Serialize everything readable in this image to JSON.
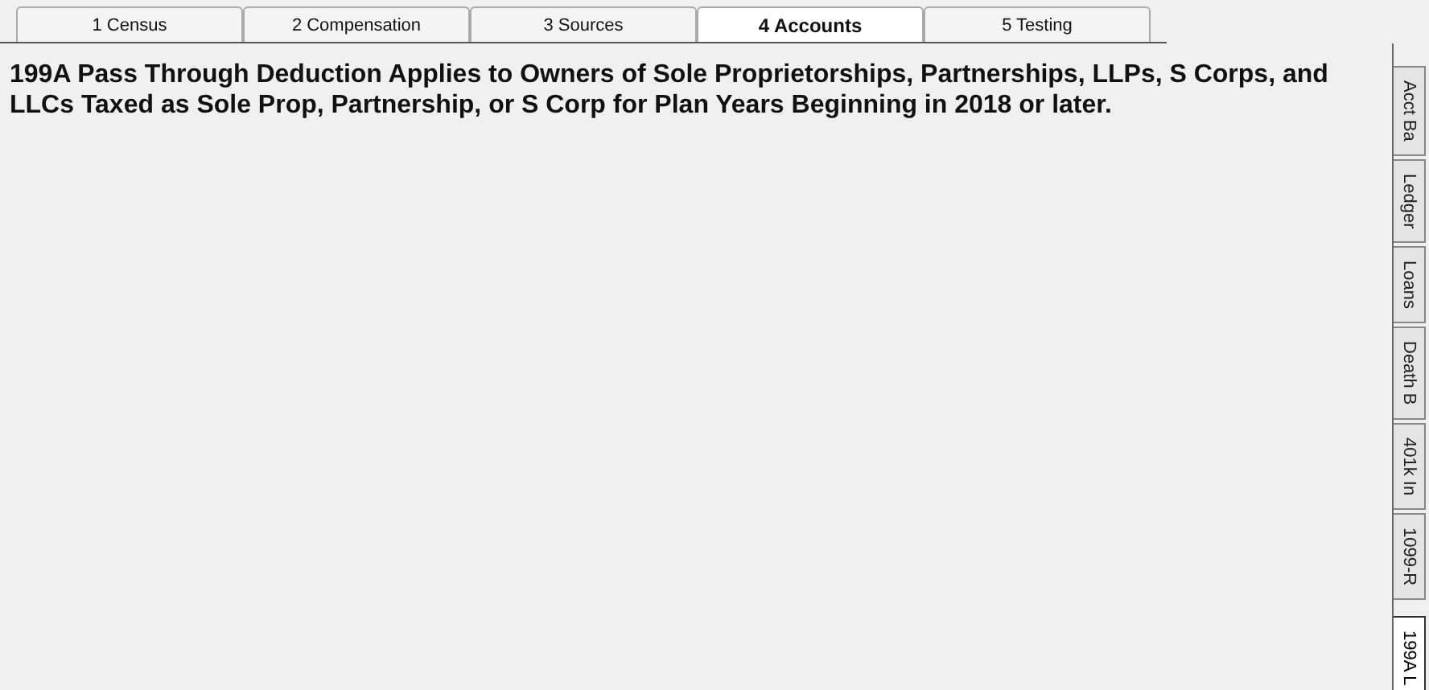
{
  "tabs": [
    {
      "label": "1 Census",
      "selected": false
    },
    {
      "label": "2 Compensation",
      "selected": false
    },
    {
      "label": "3 Sources",
      "selected": false
    },
    {
      "label": "4 Accounts",
      "selected": true
    },
    {
      "label": "5 Testing",
      "selected": false
    }
  ],
  "notice": "199A Pass Through Deduction Applies to Owners of Sole Proprietorships, Partnerships, LLPs, S Corps, and LLCs Taxed as Sole Prop, Partnership, or S Corp for Plan Years Beginning in 2018 or later.",
  "side_tabs": [
    {
      "label": "Acct Ba",
      "selected": false
    },
    {
      "label": "Ledger",
      "selected": false
    },
    {
      "label": "Loans",
      "selected": false
    },
    {
      "label": "Death B",
      "selected": false
    },
    {
      "label": "401k In",
      "selected": false
    },
    {
      "label": "1099-R",
      "selected": false
    },
    {
      "label": "199A L",
      "selected": true
    }
  ]
}
